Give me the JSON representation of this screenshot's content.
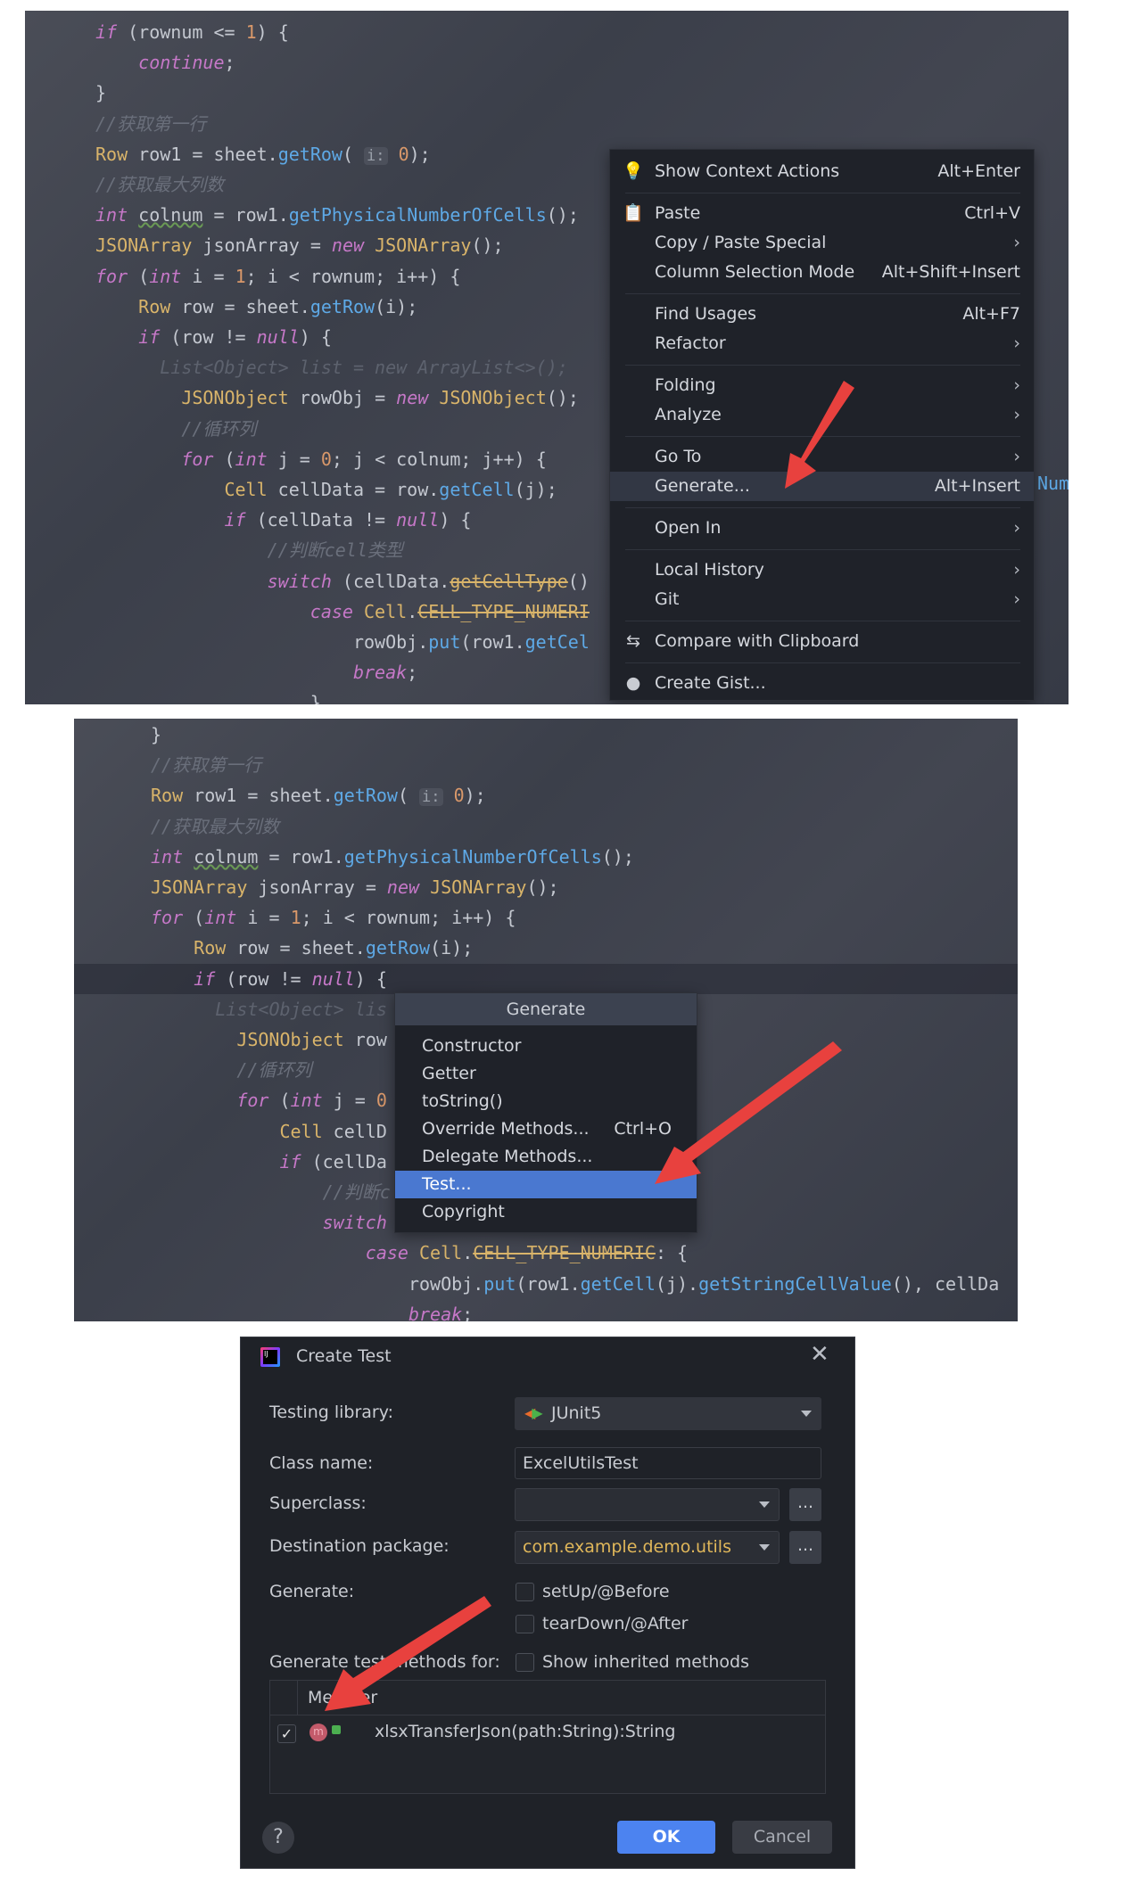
{
  "panel1": {
    "code_lines": [
      {
        "indent": 0,
        "tokens": [
          [
            "if",
            "kw"
          ],
          [
            " (rownum <= ",
            ""
          ],
          [
            "1",
            "num"
          ],
          [
            ") {",
            ""
          ]
        ]
      },
      {
        "indent": 4,
        "tokens": [
          [
            "continue",
            "kw"
          ],
          [
            ";",
            ""
          ]
        ]
      },
      {
        "indent": 0,
        "tokens": [
          [
            "}",
            ""
          ]
        ]
      },
      {
        "indent": 0,
        "tokens": [
          [
            "//获取第一行",
            "cmt"
          ]
        ]
      },
      {
        "indent": 0,
        "tokens": [
          [
            "Row",
            "type"
          ],
          [
            " row1 = sheet.",
            ""
          ],
          [
            "getRow",
            "fn"
          ],
          [
            "( ",
            ""
          ],
          [
            "i:",
            "hint"
          ],
          [
            " ",
            ""
          ],
          [
            "0",
            "num"
          ],
          [
            ");",
            ""
          ]
        ]
      },
      {
        "indent": 0,
        "tokens": [
          [
            "//获取最大列数",
            "cmt"
          ]
        ]
      },
      {
        "indent": 0,
        "tokens": [
          [
            "int",
            "kw"
          ],
          [
            " ",
            ""
          ],
          [
            "colnum",
            "warn"
          ],
          [
            " = row1.",
            ""
          ],
          [
            "getPhysicalNumberOfCells",
            "fn"
          ],
          [
            "();",
            ""
          ]
        ]
      },
      {
        "indent": 0,
        "tokens": [
          [
            "JSONArray",
            "type"
          ],
          [
            " jsonArray = ",
            ""
          ],
          [
            "new",
            "kw"
          ],
          [
            " ",
            ""
          ],
          [
            "JSONArray",
            "type"
          ],
          [
            "();",
            ""
          ]
        ]
      },
      {
        "indent": 0,
        "tokens": [
          [
            "for",
            "kw"
          ],
          [
            " (",
            ""
          ],
          [
            "int",
            "kw"
          ],
          [
            " i = ",
            ""
          ],
          [
            "1",
            "num"
          ],
          [
            "; i < rownum; i++) {",
            ""
          ]
        ]
      },
      {
        "indent": 4,
        "tokens": [
          [
            "Row",
            "type"
          ],
          [
            " row = sheet.",
            ""
          ],
          [
            "getRow",
            "fn"
          ],
          [
            "(i);",
            ""
          ]
        ]
      },
      {
        "indent": 4,
        "tokens": [
          [
            "if",
            "kw"
          ],
          [
            " (row != ",
            ""
          ],
          [
            "null",
            "kw"
          ],
          [
            ") {",
            ""
          ]
        ]
      },
      {
        "indent": 6,
        "tokens": [
          [
            "List<Object> list = new ArrayList<>();",
            "faint"
          ]
        ]
      },
      {
        "indent": 8,
        "tokens": [
          [
            "JSONObject",
            "type"
          ],
          [
            " rowObj = ",
            ""
          ],
          [
            "new",
            "kw"
          ],
          [
            " ",
            ""
          ],
          [
            "JSONObject",
            "type"
          ],
          [
            "();",
            ""
          ]
        ]
      },
      {
        "indent": 8,
        "tokens": [
          [
            "//循环列",
            "cmt"
          ]
        ]
      },
      {
        "indent": 8,
        "tokens": [
          [
            "for",
            "kw"
          ],
          [
            " (",
            ""
          ],
          [
            "int",
            "kw"
          ],
          [
            " j = ",
            ""
          ],
          [
            "0",
            "num"
          ],
          [
            "; j < colnum; j++) {",
            ""
          ]
        ]
      },
      {
        "indent": 12,
        "tokens": [
          [
            "Cell",
            "type"
          ],
          [
            " cellData = row.",
            ""
          ],
          [
            "getCell",
            "fn"
          ],
          [
            "(j);",
            ""
          ]
        ]
      },
      {
        "indent": 12,
        "tokens": [
          [
            "if",
            "kw"
          ],
          [
            " (cellData != ",
            ""
          ],
          [
            "null",
            "kw"
          ],
          [
            ") {",
            ""
          ]
        ]
      },
      {
        "indent": 16,
        "tokens": [
          [
            "//判断cell类型",
            "cmt"
          ]
        ]
      },
      {
        "indent": 16,
        "tokens": [
          [
            "switch",
            "kw"
          ],
          [
            " (cellData.",
            ""
          ],
          [
            "getCellType",
            "dep"
          ],
          [
            "()",
            ""
          ]
        ]
      },
      {
        "indent": 20,
        "tokens": [
          [
            "case",
            "kw"
          ],
          [
            " ",
            ""
          ],
          [
            "Cell",
            "type"
          ],
          [
            ".",
            ""
          ],
          [
            "CELL_TYPE_NUMERI",
            "dep"
          ]
        ]
      },
      {
        "indent": 24,
        "tokens": [
          [
            "rowObj.",
            ""
          ],
          [
            "put",
            "fn"
          ],
          [
            "(row1.",
            ""
          ],
          [
            "getCel",
            "fn"
          ]
        ]
      },
      {
        "indent": 24,
        "tokens": [
          [
            "break",
            "kw"
          ],
          [
            ";",
            ""
          ]
        ]
      },
      {
        "indent": 20,
        "tokens": [
          [
            "}",
            ""
          ]
        ]
      }
    ],
    "overflow_text": "Num",
    "context_menu": [
      {
        "label": "Show Context Actions",
        "shortcut": "Alt+Enter",
        "icon": "lightbulb-icon",
        "glyph": "💡"
      },
      {
        "separator": true
      },
      {
        "label": "Paste",
        "shortcut": "Ctrl+V",
        "icon": "clipboard-icon",
        "glyph": "📋"
      },
      {
        "label": "Copy / Paste Special",
        "submenu": true
      },
      {
        "label": "Column Selection Mode",
        "shortcut": "Alt+Shift+Insert"
      },
      {
        "separator": true
      },
      {
        "label": "Find Usages",
        "shortcut": "Alt+F7"
      },
      {
        "label": "Refactor",
        "submenu": true
      },
      {
        "separator": true
      },
      {
        "label": "Folding",
        "submenu": true
      },
      {
        "label": "Analyze",
        "submenu": true
      },
      {
        "separator": true
      },
      {
        "label": "Go To",
        "submenu": true
      },
      {
        "label": "Generate...",
        "shortcut": "Alt+Insert",
        "selected": true
      },
      {
        "separator": true
      },
      {
        "label": "Open In",
        "submenu": true
      },
      {
        "separator": true
      },
      {
        "label": "Local History",
        "submenu": true
      },
      {
        "label": "Git",
        "submenu": true
      },
      {
        "separator": true
      },
      {
        "label": "Compare with Clipboard",
        "icon": "compare-clipboard-icon",
        "glyph": "⇆"
      },
      {
        "separator": true
      },
      {
        "label": "Create Gist...",
        "icon": "github-icon",
        "glyph": "●"
      }
    ]
  },
  "panel2": {
    "code_lines": [
      {
        "indent": 0,
        "tokens": [
          [
            "}",
            ""
          ]
        ]
      },
      {
        "indent": 0,
        "tokens": [
          [
            "//获取第一行",
            "cmt"
          ]
        ]
      },
      {
        "indent": 0,
        "tokens": [
          [
            "Row",
            "type"
          ],
          [
            " row1 = sheet.",
            ""
          ],
          [
            "getRow",
            "fn"
          ],
          [
            "( ",
            ""
          ],
          [
            "i:",
            "hint"
          ],
          [
            " ",
            ""
          ],
          [
            "0",
            "num"
          ],
          [
            ");",
            ""
          ]
        ]
      },
      {
        "indent": 0,
        "tokens": [
          [
            "//获取最大列数",
            "cmt"
          ]
        ]
      },
      {
        "indent": 0,
        "tokens": [
          [
            "int",
            "kw"
          ],
          [
            " ",
            ""
          ],
          [
            "colnum",
            "warn"
          ],
          [
            " = row1.",
            ""
          ],
          [
            "getPhysicalNumberOfCells",
            "fn"
          ],
          [
            "();",
            ""
          ]
        ]
      },
      {
        "indent": 0,
        "tokens": [
          [
            "JSONArray",
            "type"
          ],
          [
            " jsonArray = ",
            ""
          ],
          [
            "new",
            "kw"
          ],
          [
            " ",
            ""
          ],
          [
            "JSONArray",
            "type"
          ],
          [
            "();",
            ""
          ]
        ]
      },
      {
        "indent": 0,
        "tokens": [
          [
            "for",
            "kw"
          ],
          [
            " (",
            ""
          ],
          [
            "int",
            "kw"
          ],
          [
            " i = ",
            ""
          ],
          [
            "1",
            "num"
          ],
          [
            "; i < rownum; i++) {",
            ""
          ]
        ]
      },
      {
        "indent": 4,
        "tokens": [
          [
            "Row",
            "type"
          ],
          [
            " row = sheet.",
            ""
          ],
          [
            "getRow",
            "fn"
          ],
          [
            "(i);",
            ""
          ]
        ]
      },
      {
        "indent": 4,
        "tokens": [
          [
            "if",
            "kw"
          ],
          [
            " (row != ",
            ""
          ],
          [
            "null",
            "kw"
          ],
          [
            ") {",
            ""
          ]
        ],
        "highlight": true
      },
      {
        "indent": 6,
        "tokens": [
          [
            "List<Object> lis",
            "faint"
          ]
        ]
      },
      {
        "indent": 8,
        "tokens": [
          [
            "JSONObject",
            "type"
          ],
          [
            " row",
            ""
          ]
        ]
      },
      {
        "indent": 8,
        "tokens": [
          [
            "//循环列",
            "cmt"
          ]
        ]
      },
      {
        "indent": 8,
        "tokens": [
          [
            "for",
            "kw"
          ],
          [
            " (",
            ""
          ],
          [
            "int",
            "kw"
          ],
          [
            " j = ",
            ""
          ],
          [
            "0",
            "num"
          ]
        ]
      },
      {
        "indent": 12,
        "tokens": [
          [
            "Cell",
            "type"
          ],
          [
            " cellD",
            ""
          ]
        ]
      },
      {
        "indent": 12,
        "tokens": [
          [
            "if",
            "kw"
          ],
          [
            " (cellDa",
            ""
          ]
        ]
      },
      {
        "indent": 16,
        "tokens": [
          [
            "//判断c",
            "cmt"
          ]
        ]
      },
      {
        "indent": 16,
        "tokens": [
          [
            "switch",
            "kw"
          ]
        ]
      },
      {
        "indent": 20,
        "tokens": [
          [
            "case",
            "kw"
          ],
          [
            " ",
            ""
          ],
          [
            "Cell",
            "type"
          ],
          [
            ".",
            ""
          ],
          [
            "CELL_TYPE_NUMERIC",
            "dep"
          ],
          [
            ": {",
            ""
          ]
        ]
      },
      {
        "indent": 24,
        "tokens": [
          [
            "rowObj.",
            ""
          ],
          [
            "put",
            "fn"
          ],
          [
            "(row1.",
            ""
          ],
          [
            "getCell",
            "fn"
          ],
          [
            "(j).",
            ""
          ],
          [
            "getStringCellValue",
            "fn"
          ],
          [
            "(), cellDa",
            ""
          ]
        ]
      },
      {
        "indent": 24,
        "tokens": [
          [
            "break",
            "kw"
          ],
          [
            ";",
            ""
          ]
        ]
      }
    ],
    "generate_popup": {
      "title": "Generate",
      "items": [
        {
          "label": "Constructor"
        },
        {
          "label": "Getter"
        },
        {
          "label": "toString()"
        },
        {
          "label": "Override Methods...",
          "shortcut": "Ctrl+O"
        },
        {
          "label": "Delegate Methods..."
        },
        {
          "label": "Test...",
          "selected": true
        },
        {
          "label": "Copyright"
        }
      ]
    }
  },
  "dialog": {
    "title": "Create Test",
    "testing_library_label": "Testing library:",
    "testing_library_value": "JUnit5",
    "class_name_label": "Class name:",
    "class_name_value": "ExcelUtilsTest",
    "superclass_label": "Superclass:",
    "superclass_value": "",
    "destination_label": "Destination package:",
    "destination_value": "com.example.demo.utils",
    "browse_label": "...",
    "generate_label": "Generate:",
    "setup_label": "setUp/@Before",
    "setup_checked": false,
    "teardown_label": "tearDown/@After",
    "teardown_checked": false,
    "methods_for_label": "Generate test methods for:",
    "inherited_label": "Show inherited methods",
    "inherited_checked": false,
    "table_header": "Member",
    "members": [
      {
        "signature": "xlsxTransferJson(path:String):String",
        "checked": true
      }
    ],
    "help_label": "?",
    "ok_label": "OK",
    "cancel_label": "Cancel"
  },
  "colors": {
    "accent": "#4a78d0",
    "ok_button": "#4c83f0",
    "arrow": "#e8413e",
    "package_text": "#e0b75a"
  }
}
